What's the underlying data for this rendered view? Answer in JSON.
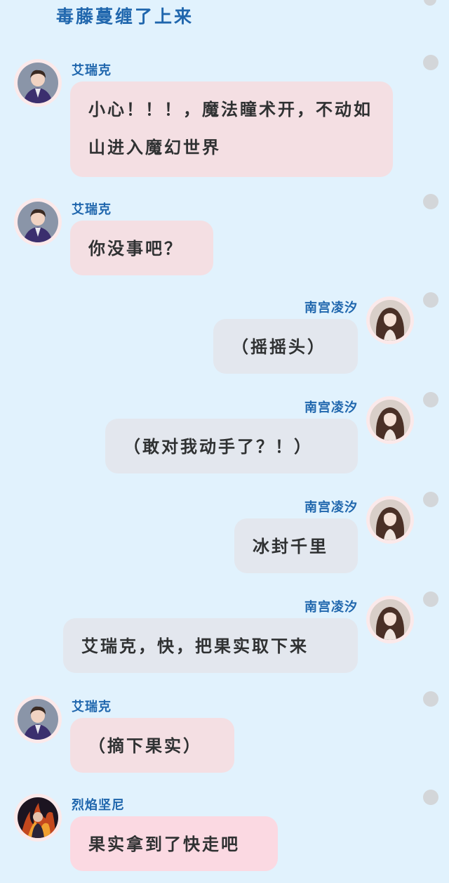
{
  "title": "毒藤蔓缠了上来",
  "messages": [
    {
      "side": "left",
      "speaker": "艾瑞克",
      "text": "小心！！！，魔法瞳术开，不动如山进入魔幻世界",
      "avatar_icon": "boy-in-purple-uniform-avatar"
    },
    {
      "side": "left",
      "speaker": "艾瑞克",
      "text": "你没事吧？",
      "avatar_icon": "boy-in-purple-uniform-avatar"
    },
    {
      "side": "right",
      "speaker": "南宫凌汐",
      "text": "（摇摇头）",
      "avatar_icon": "girl-with-long-brown-hair-avatar"
    },
    {
      "side": "right",
      "speaker": "南宫凌汐",
      "text": "（敢对我动手了？！）",
      "avatar_icon": "girl-with-long-brown-hair-avatar"
    },
    {
      "side": "right",
      "speaker": "南宫凌汐",
      "text": "冰封千里",
      "avatar_icon": "girl-with-long-brown-hair-avatar"
    },
    {
      "side": "right",
      "speaker": "南宫凌汐",
      "text": "艾瑞克，快，把果实取下来",
      "avatar_icon": "girl-with-long-brown-hair-avatar"
    },
    {
      "side": "left",
      "speaker": "艾瑞克",
      "text": "（摘下果实）",
      "avatar_icon": "boy-in-purple-uniform-avatar"
    },
    {
      "side": "left",
      "speaker": "烈焰坚尼",
      "text": "果实拿到了快走吧",
      "avatar_icon": "dark-figure-with-flames-avatar"
    }
  ],
  "colors": {
    "background": "#e1f2fd",
    "name": "#1f66ad",
    "left_bubble": "#f4dfe3",
    "right_bubble": "#e3e7ee",
    "pink_bubble": "#fbd9e2"
  }
}
